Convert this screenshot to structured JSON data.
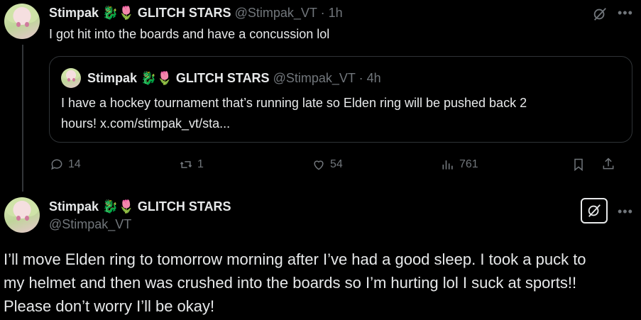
{
  "post1": {
    "display_name": "Stimpak",
    "org_label": "GLITCH STARS",
    "handle": "@Stimpak_VT",
    "time": "1h",
    "text": "I got hit into the boards and have a concussion lol",
    "quote": {
      "display_name": "Stimpak",
      "org_label": "GLITCH STARS",
      "handle": "@Stimpak_VT",
      "time": "4h",
      "text_line1": "I have a hockey tournament that’s running late so Elden ring will be pushed back 2",
      "text_line2": "hours! x.com/stimpak_vt/sta..."
    },
    "stats": {
      "replies": "14",
      "reposts": "1",
      "likes": "54",
      "views": "761"
    }
  },
  "post2": {
    "display_name": "Stimpak",
    "org_label": "GLITCH STARS",
    "handle": "@Stimpak_VT",
    "text_line1": "I’ll move Elden ring to tomorrow morning after I’ve had a good sleep. I took a puck to",
    "text_line2": "my helmet and then was crushed into the boards so I’m hurting lol I suck at sports!!",
    "text_line3": "Please don’t worry I’ll be okay!"
  },
  "icons": {
    "dragon": "🐉",
    "tulip": "🌷",
    "separator": "·"
  }
}
